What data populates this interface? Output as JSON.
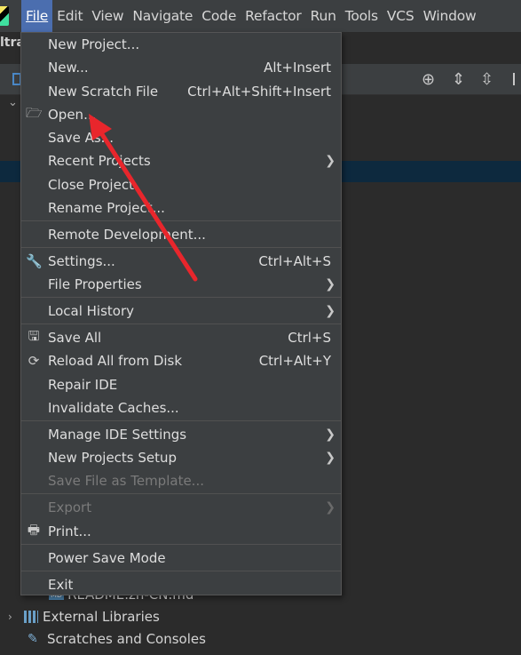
{
  "menubar": {
    "items": [
      {
        "label": "File",
        "active": true
      },
      {
        "label": "Edit"
      },
      {
        "label": "View"
      },
      {
        "label": "Navigate"
      },
      {
        "label": "Code"
      },
      {
        "label": "Refactor"
      },
      {
        "label": "Run"
      },
      {
        "label": "Tools"
      },
      {
        "label": "VCS"
      },
      {
        "label": "Window"
      }
    ]
  },
  "project": {
    "title_fragment": "ltra",
    "md_file": "README.zh-CN.md",
    "md_badge": "MD",
    "external_libraries": "External Libraries",
    "scratches": "Scratches and Consoles"
  },
  "file_menu": {
    "new_project": "New Project...",
    "new": "New...",
    "new_shortcut": "Alt+Insert",
    "new_scratch": "New Scratch File",
    "new_scratch_shortcut": "Ctrl+Alt+Shift+Insert",
    "open": "Open...",
    "save_as": "Save As...",
    "recent_projects": "Recent Projects",
    "close_project": "Close Project",
    "rename_project": "Rename Project...",
    "remote_development": "Remote Development...",
    "settings": "Settings...",
    "settings_shortcut": "Ctrl+Alt+S",
    "file_properties": "File Properties",
    "local_history": "Local History",
    "save_all": "Save All",
    "save_all_shortcut": "Ctrl+S",
    "reload": "Reload All from Disk",
    "reload_shortcut": "Ctrl+Alt+Y",
    "repair_ide": "Repair IDE",
    "invalidate_caches": "Invalidate Caches...",
    "manage_ide_settings": "Manage IDE Settings",
    "new_projects_setup": "New Projects Setup",
    "save_file_as_template": "Save File as Template...",
    "export": "Export",
    "print": "Print...",
    "power_save_mode": "Power Save Mode",
    "exit": "Exit"
  },
  "annotation": {
    "color": "#e8262c"
  }
}
